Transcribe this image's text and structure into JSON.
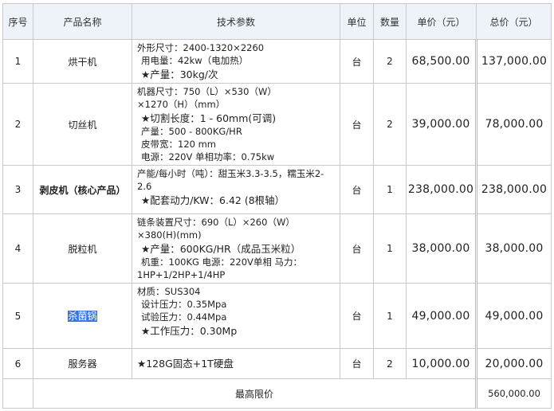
{
  "headers": {
    "no": "序号",
    "name": "产品名称",
    "spec": "技术参数",
    "unit": "单位",
    "qty": "数量",
    "price": "单价（元）",
    "total": "总价（元）"
  },
  "rows": [
    {
      "no": "1",
      "name": "烘干机",
      "spec": [
        "外形尺寸：2400-1320×2260",
        "用电量：42kw（电加热）",
        "★产量：30kg/次"
      ],
      "unit": "台",
      "qty": "2",
      "price": "68,500.00",
      "total": "137,000.00"
    },
    {
      "no": "2",
      "name": "切丝机",
      "spec": [
        "机器尺寸：750（L）×530（W）",
        "×1270（H）（mm）",
        "★切割长度：1 - 60mm(可调)",
        "产量：500 - 800KG/HR",
        "皮带宽：120 mm",
        "电源：220V   单相功率：0.75kw"
      ],
      "unit": "台",
      "qty": "2",
      "price": "39,000.00",
      "total": "78,000.00"
    },
    {
      "no": "3",
      "name": "剥皮机（核心产品）",
      "spec": [
        "产能/每小时（吨）：甜玉米3.3-3.5，糯玉米2-2.6",
        "★配套动力/KW：6.42 (8根轴）"
      ],
      "unit": "台",
      "qty": "1",
      "price": "238,000.00",
      "total": "238,000.00"
    },
    {
      "no": "4",
      "name": "脱粒机",
      "spec": [
        "链条装置尺寸：690（L）×260（W）",
        "×380(H)(mm)",
        "★产量：600KG/HR（成品玉米粒）",
        "机重：100KG  电源：220V单相  马力：",
        "1HP+1/2HP+1/4HP"
      ],
      "unit": "台",
      "qty": "1",
      "price": "38,000.00",
      "total": "38,000.00"
    },
    {
      "no": "5",
      "name": "杀菌锅",
      "spec": [
        "材质：SUS304",
        "设计压力：0.35Mpa",
        "试验压力：0.44Mpa",
        "★工作压力：0.30Mp"
      ],
      "unit": "台",
      "qty": "1",
      "price": "49,000.00",
      "total": "49,000.00"
    },
    {
      "no": "6",
      "name": "服务器",
      "spec": [
        "★128G固态+1T硬盘"
      ],
      "unit": "台",
      "qty": "2",
      "price": "10,000.00",
      "total": "20,000.00"
    }
  ],
  "footer": {
    "label": "最高限价",
    "grand_total": "560,000.00"
  }
}
